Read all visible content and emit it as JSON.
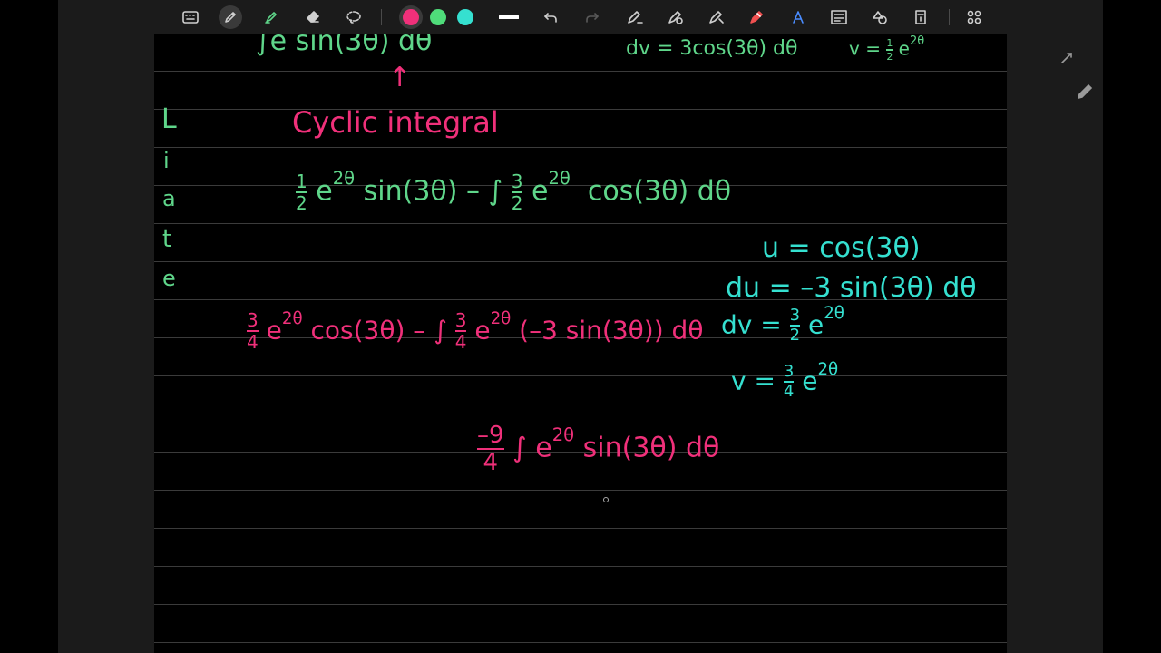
{
  "toolbar": {
    "tools": [
      "keyboard-icon",
      "pen-icon",
      "highlighter-icon",
      "eraser-icon",
      "lasso-icon"
    ],
    "pen_colors": [
      "#f0307a",
      "#4fdc7a",
      "#35e0d0"
    ],
    "actions": [
      "stroke-width-icon",
      "undo-icon",
      "redo-icon",
      "pen-settings-icon",
      "shape-pen-icon",
      "ruler-pen-icon",
      "marker-icon",
      "text-style-icon",
      "text-box-icon",
      "shapes-icon",
      "sticker-icon",
      "grid-icon"
    ]
  },
  "side_buttons": [
    "collapse-icon",
    "pencil-icon"
  ],
  "colors": {
    "green": "#5fd68a",
    "teal": "#35e0d0",
    "pink": "#f0307a",
    "page": "#000000",
    "chrome": "#1b1b1b"
  },
  "notes": {
    "top_integral": "∫e  sin(3θ) dθ",
    "top_dv": "dv = 3cos(3θ) dθ",
    "top_v_prefix": "v =",
    "top_v_num": "1",
    "top_v_den": "2",
    "top_v_e": "e",
    "top_v_exp": "2θ",
    "arrow": "↑",
    "cyclic": "Cyclic integral",
    "liate": [
      "L",
      "i",
      "a",
      "t",
      "e"
    ],
    "line1": {
      "num": "1",
      "den": "2",
      "e": "e",
      "exp": "2θ",
      "mid": "sin(3θ) – ∫",
      "num2": "3",
      "den2": "2",
      "e2": "e",
      "exp2": "2θ",
      "tail": "cos(3θ) dθ"
    },
    "u_eq": "u = cos(3θ)",
    "du_eq": "du = –3 sin(3θ) dθ",
    "dv_eq_prefix": "dv =",
    "dv_num": "3",
    "dv_den": "2",
    "dv_e": "e",
    "dv_exp": "2θ",
    "v_eq_prefix": "v =",
    "v_num": "3",
    "v_den": "4",
    "v_e": "e",
    "v_exp": "2θ",
    "line2": {
      "num": "3",
      "den": "4",
      "e": "e",
      "exp": "2θ",
      "mid": "cos(3θ) – ∫",
      "num2": "3",
      "den2": "4",
      "e2": "e",
      "exp2": "2θ",
      "tail": "(–3 sin(3θ)) dθ"
    },
    "line3": {
      "num": "–9",
      "den": "4",
      "int": "∫",
      "e": "e",
      "exp": "2θ",
      "tail": "sin(3θ) dθ"
    }
  }
}
